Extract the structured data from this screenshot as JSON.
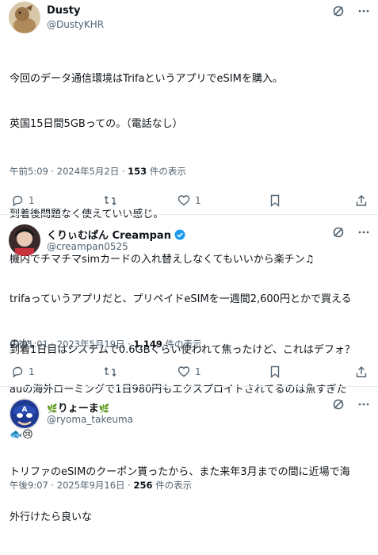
{
  "tweets": [
    {
      "name": "Dusty",
      "handle": "@DustyKHR",
      "lines": [
        "今回のデータ通信環境はTrifaというアプリでeSIMを購入。",
        "英国15日間5GBっての。（電話なし）",
        "",
        "到着後問題なく使えていい感じ。",
        "機内でチマチマsimカードの入れ替えしなくてもいいから楽チン♫",
        "",
        "到着1日目はシステムで0.6GBくらい使われて焦ったけど、これはデフォ？"
      ],
      "time": "午前5:09 · 2024年5月2日 · ",
      "views": "153",
      "views_suffix": " 件の表示",
      "reply_count": "1",
      "like_count": "1"
    },
    {
      "name": "くりぃむぱん Creampan",
      "handle": "@creampan0525",
      "lines": [
        "trifaっていうアプリだと、プリペイドeSIMを一週間2,600円とかで買える",
        "のか。",
        "auの海外ローミングで1日980円もエクスプロイトされてるのは魚すぎた",
        "🐟😢"
      ],
      "time": "午後1:01 · 2023年5月19日 · ",
      "views": "1,149",
      "views_suffix": " 件の表示",
      "reply_count": "1",
      "like_count": "1"
    },
    {
      "name_prefix": "🌿",
      "name": "りょーま",
      "name_suffix": "🌿",
      "handle": "@ryoma_takeuma",
      "lines": [
        "トリファのeSIMのクーポン貰ったから、また来年3月までの間に近場で海",
        "外行けたら良いな"
      ],
      "time": "午後9:07 · 2025年9月16日 · ",
      "views": "256",
      "views_suffix": " 件の表示"
    }
  ],
  "colors": {
    "text": "#0f1419",
    "muted": "#536471",
    "divider": "#e6ecf0",
    "verified": "#1d9bf0"
  },
  "icons": [
    "grok-icon",
    "more-icon",
    "reply-icon",
    "retweet-icon",
    "like-icon",
    "bookmark-icon",
    "share-icon",
    "verified-badge-icon"
  ]
}
